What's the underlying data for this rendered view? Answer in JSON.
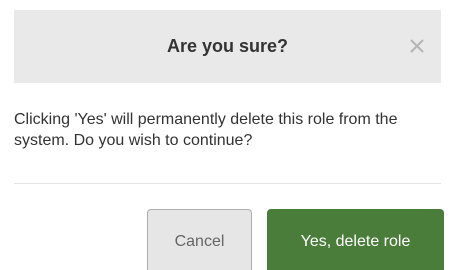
{
  "dialog": {
    "title": "Are you sure?",
    "close_icon": "close-icon",
    "message": "Clicking 'Yes' will permanently delete this role from the system. Do you wish to continue?",
    "cancel_label": "Cancel",
    "confirm_label": "Yes, delete role"
  },
  "colors": {
    "header_background": "#e9e9e9",
    "confirm_button": "#4a7d3a",
    "cancel_button": "#e6e6e6",
    "text": "#333333"
  }
}
